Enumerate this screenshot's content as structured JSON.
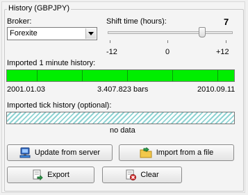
{
  "group_title": "History (GBPJPY)",
  "broker": {
    "label": "Broker:",
    "value": "Forexite"
  },
  "shift": {
    "label": "Shift time (hours):",
    "value": "7",
    "min_label": "-12",
    "mid_label": "0",
    "max_label": "+12"
  },
  "minute_history": {
    "label": "Imported 1 minute history:",
    "start": "2001.01.03",
    "count": "3.407.823 bars",
    "end": "2010.09.11",
    "fill_fraction": 1.0
  },
  "tick_history": {
    "label": "Imported tick history (optional):",
    "status": "no data"
  },
  "buttons": {
    "update": "Update from server",
    "import": "Import from a file",
    "export": "Export",
    "clear": "Clear"
  },
  "icons": {
    "update": "computer-network-icon",
    "import": "folder-import-icon",
    "export": "export-document-icon",
    "clear": "delete-document-icon"
  },
  "colors": {
    "progress": "#00ee00",
    "tick_hatch": "#8fd3d3"
  }
}
